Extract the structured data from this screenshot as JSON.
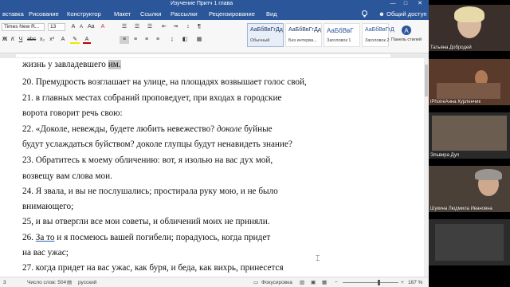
{
  "word": {
    "title": "Изучение Притч 1 глава",
    "window_controls": [
      "—",
      "□",
      "✕"
    ],
    "tabs": [
      "вставка",
      "Рисование",
      "Конструктор",
      "Макет",
      "Ссылки",
      "Рассылки",
      "Рецензирование",
      "Вид"
    ],
    "share_label": "Общий доступ",
    "font_name": "Times New R...",
    "font_size": "13",
    "styles": [
      {
        "sample": "АаБбВвГгДд",
        "name": "Обычный"
      },
      {
        "sample": "АаБбВвГгДд",
        "name": "Без интерва..."
      },
      {
        "sample": "АаБбВвГ",
        "name": "Заголовок 1"
      },
      {
        "sample": "АаБбВвГгД",
        "name": "Заголовок 2"
      }
    ],
    "styles_pane_label": "Панель стилей",
    "status": {
      "page": "3",
      "word_count": "Число слов: 504",
      "language": "русский",
      "focus": "Фокусировка",
      "zoom": "167 %"
    }
  },
  "document": {
    "line1_pre": "жизнь у завладевшего ",
    "line1_hl": "им.",
    "line2": "20. Премудрость возглашает на улице, на площадях возвышает голос свой,",
    "line3": "21. в главных местах собраний проповедует, при входах в городские",
    "line4": "ворота говорит речь свою:",
    "line5_pre": "22. «Доколе, невежды, будете любить невежество? ",
    "line5_it": "доколе",
    "line5_post": " буйные",
    "line6": "будут услаждаться буйством? доколе глупцы будут ненавидеть знание?",
    "line7": "23. Обратитесь к моему обличению: вот, я изолью на вас дух мой,",
    "line8": "возвещу вам слова мои.",
    "line9": "24. Я звала, и вы не послушались; простирала руку мою, и не было",
    "line10": "внимающего;",
    "line11": "25, и вы отвергли все мои советы, и обличений моих не приняли.",
    "line12_num": "26. ",
    "line12_ul": "За то",
    "line12_post": " и я посмеюсь вашей погибели; порадуюсь, когда придет",
    "line13": "на вас ужас;",
    "line14": "27. когда придет на вас ужас, как буря, и беда, как вихрь, принесется"
  },
  "participants": [
    {
      "name": "Татьяна Добродей"
    },
    {
      "name": "iPhoneАнна Курленчик"
    },
    {
      "name": "Эльвира Дуп"
    },
    {
      "name": "Шукина Людмила Ивановна"
    },
    {
      "name": ""
    }
  ]
}
